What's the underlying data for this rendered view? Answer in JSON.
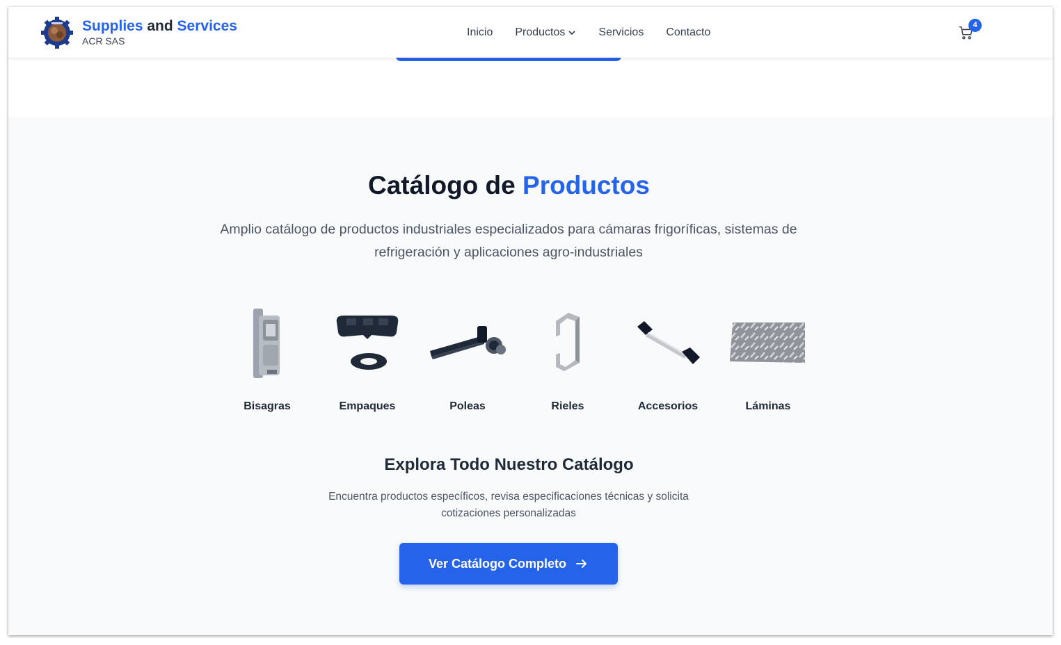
{
  "header": {
    "brand_part1": "Supplies",
    "brand_part2": " and ",
    "brand_part3": "Services",
    "brand_sub": "ACR SAS",
    "nav": [
      "Inicio",
      "Productos",
      "Servicios",
      "Contacto"
    ],
    "cart_count": "4"
  },
  "catalog": {
    "title_part1": "Catálogo de ",
    "title_part2": "Productos",
    "description": "Amplio catálogo de productos industriales especializados para cámaras frigoríficas, sistemas de refrigeración y aplicaciones agro-industriales",
    "categories": [
      "Bisagras",
      "Empaques",
      "Poleas",
      "Rieles",
      "Accesorios",
      "Láminas"
    ],
    "explore_title": "Explora Todo Nuestro Catálogo",
    "explore_desc": "Encuentra productos específicos, revisa especificaciones técnicas y solicita cotizaciones personalizadas",
    "cta_label": "Ver Catálogo Completo"
  },
  "colors": {
    "accent": "#2563eb",
    "text_dark": "#1f2937",
    "section_bg": "#f9fafb"
  },
  "icons": [
    "gear-logo-icon",
    "chevron-down-icon",
    "cart-icon",
    "arrow-right-icon"
  ]
}
